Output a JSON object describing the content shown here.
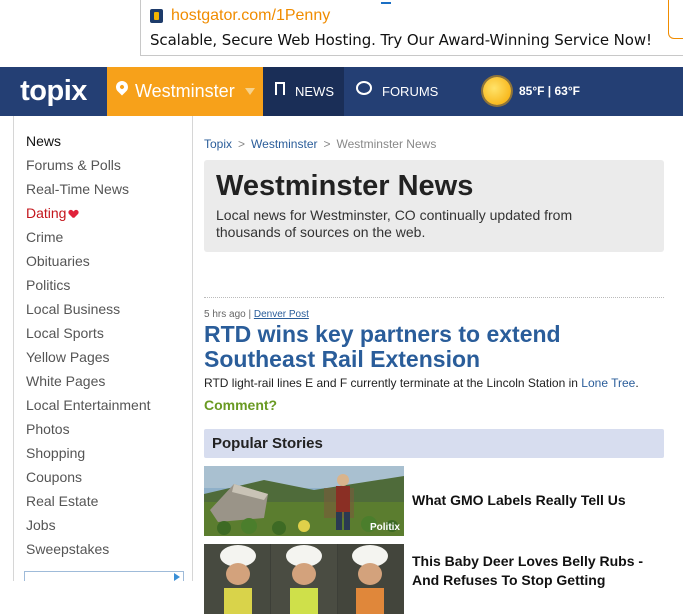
{
  "ad": {
    "url": "hostgator.com/1Penny",
    "text": "Scalable, Secure Web Hosting. Try Our Award-Winning Service Now!"
  },
  "nav": {
    "brand": "topix",
    "location": "Westminster",
    "news": "NEWS",
    "forums": "FORUMS",
    "weather": "85°F | 63°F"
  },
  "sidebar": {
    "items": [
      {
        "label": "News"
      },
      {
        "label": "Forums & Polls"
      },
      {
        "label": "Real-Time News"
      },
      {
        "label": "Dating"
      },
      {
        "label": "Crime"
      },
      {
        "label": "Obituaries"
      },
      {
        "label": "Politics"
      },
      {
        "label": "Local Business"
      },
      {
        "label": "Local Sports"
      },
      {
        "label": "Yellow Pages"
      },
      {
        "label": "White Pages"
      },
      {
        "label": "Local Entertainment"
      },
      {
        "label": "Photos"
      },
      {
        "label": "Shopping"
      },
      {
        "label": "Coupons"
      },
      {
        "label": "Real Estate"
      },
      {
        "label": "Jobs"
      },
      {
        "label": "Sweepstakes"
      }
    ]
  },
  "breadcrumb": {
    "items": [
      "Topix",
      "Westminster",
      "Westminster News"
    ],
    "separator": ">"
  },
  "hero": {
    "title": "Westminster News",
    "description": "Local news for Westminster, CO continually updated from thousands of sources on the web."
  },
  "article": {
    "time": "5 hrs ago",
    "pipe": "|",
    "source": "Denver Post",
    "headline": "RTD wins key partners to extend Southeast Rail Extension",
    "summary_prefix": "RTD light-rail lines E and F currently terminate at the Lincoln Station in ",
    "summary_link": "Lone Tree",
    "summary_suffix": ".",
    "comment": "Comment?"
  },
  "popular": {
    "title": "Popular Stories",
    "stories": [
      {
        "title": "What GMO Labels Really Tell Us",
        "source": "Politix"
      },
      {
        "title": "This Baby Deer Loves Belly Rubs - And Refuses To Stop Getting",
        "source": ""
      }
    ]
  }
}
